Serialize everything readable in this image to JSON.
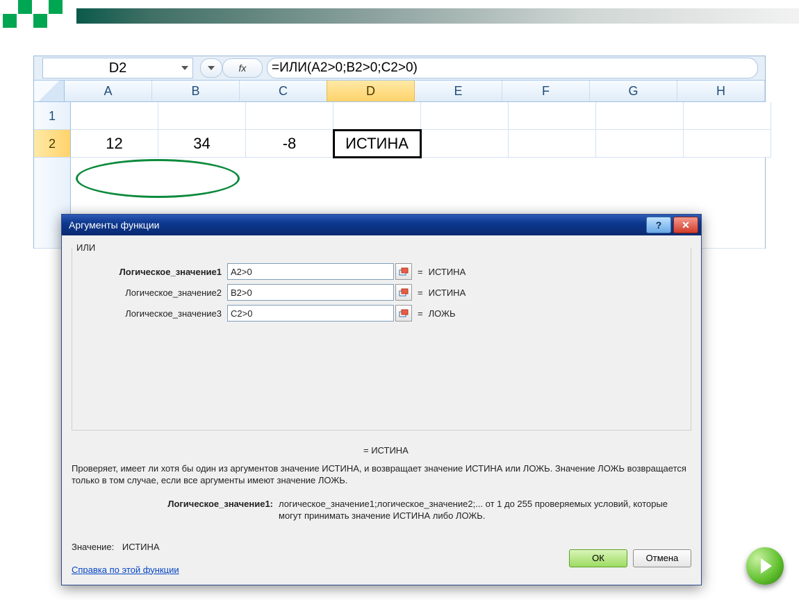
{
  "namebox": {
    "value": "D2"
  },
  "fx": {
    "label": "fx",
    "formula": "=ИЛИ(A2>0;B2>0;C2>0)"
  },
  "columns": [
    "A",
    "B",
    "C",
    "D",
    "E",
    "F",
    "G",
    "H"
  ],
  "rows": {
    "r1": {
      "label": "1"
    },
    "r2": {
      "label": "2",
      "A": "12",
      "B": "34",
      "C": "-8",
      "D": "ИСТИНА"
    }
  },
  "dialog": {
    "title": "Аргументы функции",
    "function_name": "ИЛИ",
    "args": [
      {
        "label": "Логическое_значение1",
        "value": "A2>0",
        "result": "ИСТИНА",
        "bold": true
      },
      {
        "label": "Логическое_значение2",
        "value": "B2>0",
        "result": "ИСТИНА",
        "bold": false
      },
      {
        "label": "Логическое_значение3",
        "value": "C2>0",
        "result": "ЛОЖЬ",
        "bold": false
      }
    ],
    "final_result": "=  ИСТИНА",
    "description": "Проверяет, имеет ли хотя бы один из аргументов значение ИСТИНА, и возвращает значение ИСТИНА или ЛОЖЬ. Значение ЛОЖЬ возвращается только в том случае, если все аргументы имеют значение ЛОЖЬ.",
    "arg_hint_label": "Логическое_значение1:",
    "arg_hint_text": "логическое_значение1;логическое_значение2;... от 1 до 255 проверяемых условий, которые могут принимать значение ИСТИНА либо ЛОЖЬ.",
    "value_label": "Значение:",
    "value": "ИСТИНА",
    "help_link": "Справка по этой функции",
    "ok": "ОК",
    "cancel": "Отмена"
  }
}
